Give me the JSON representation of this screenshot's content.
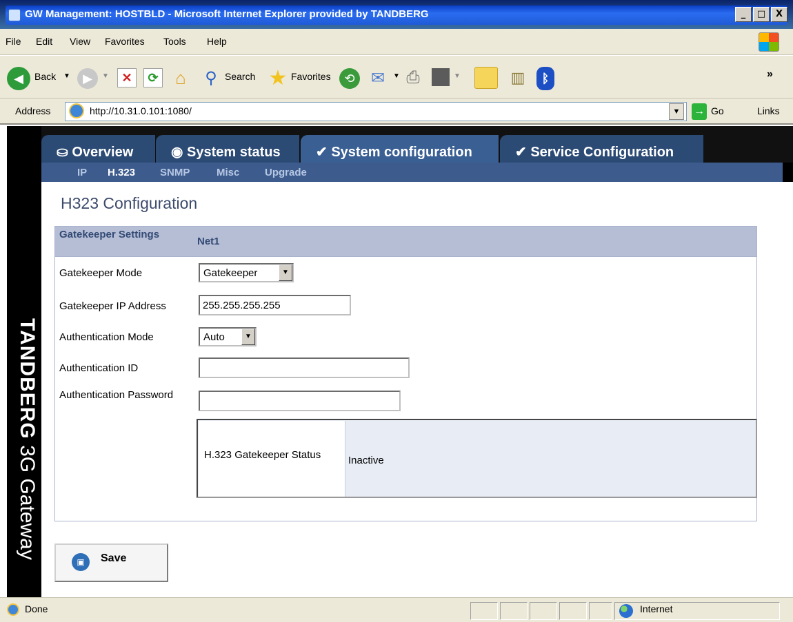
{
  "window": {
    "title": "GW Management: HOSTBLD - Microsoft Internet Explorer provided by TANDBERG",
    "controls": [
      "_",
      "□",
      "X"
    ]
  },
  "menu": [
    "File",
    "Edit",
    "View",
    "Favorites",
    "Tools",
    "Help"
  ],
  "toolbar": {
    "back": "Back",
    "search": "Search",
    "favorites": "Favorites"
  },
  "address": {
    "label": "Address",
    "url": "http://10.31.0.101:1080/",
    "go": "Go",
    "links": "Links"
  },
  "app": {
    "brand_bold": "TANDBERG",
    "brand_rest": " 3G Gateway",
    "tabs": [
      "Overview",
      "System status",
      "System configuration",
      "Service Configuration"
    ],
    "active_tab": "System configuration",
    "subnav": [
      "IP",
      "H.323",
      "SNMP",
      "Misc",
      "Upgrade"
    ],
    "current_subnav": "H.323",
    "heading": "H323 Configuration"
  },
  "config": {
    "section_title": "Gatekeeper Settings",
    "column": "Net1",
    "rows": {
      "gatekeeper_mode_label": "Gatekeeper Mode",
      "gatekeeper_mode_value": "Gatekeeper",
      "gatekeeper_ip_label": "Gatekeeper IP Address",
      "gatekeeper_ip_value": "255.255.255.255",
      "auth_mode_label": "Authentication Mode",
      "auth_mode_value": "Auto",
      "auth_id_label": "Authentication ID",
      "auth_id_value": "",
      "auth_password_label": "Authentication Password",
      "auth_password_value": ""
    },
    "status": {
      "label": "H.323 Gatekeeper Status",
      "value": "Inactive"
    },
    "save": "Save"
  },
  "statusbar": {
    "text": "Done",
    "zone": "Internet"
  },
  "colors": {
    "tab_blue": "#2b4a74",
    "subnav_blue": "#3d5c8d",
    "section_header": "#b6bed6"
  }
}
